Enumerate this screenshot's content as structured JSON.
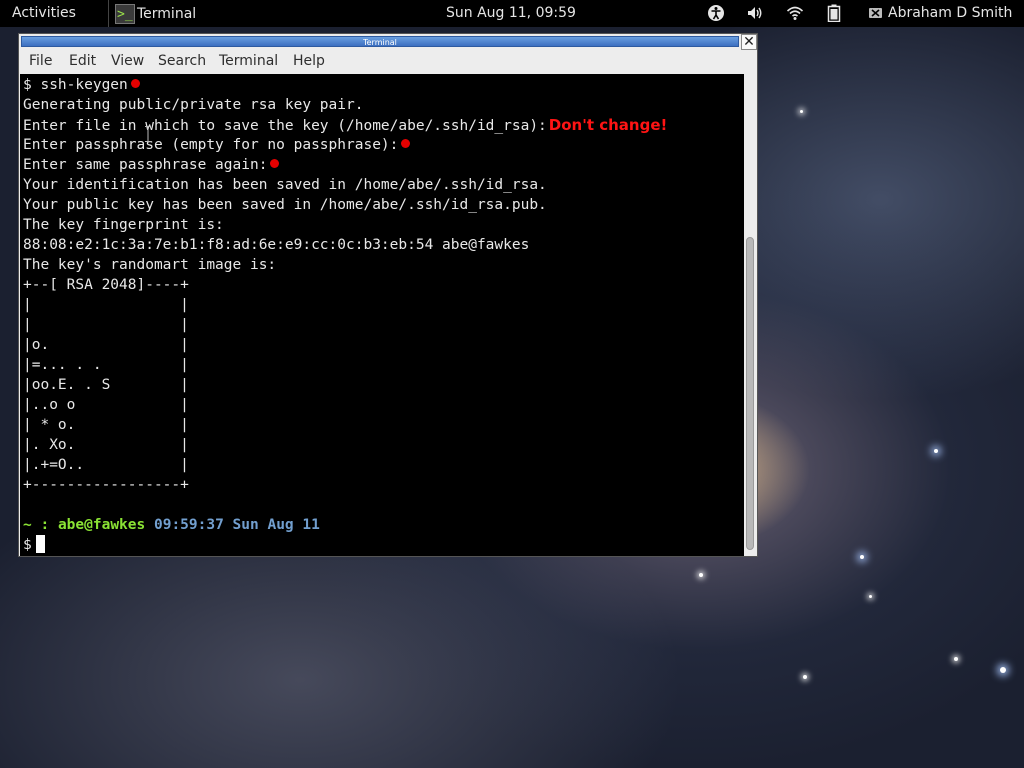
{
  "topbar": {
    "activities": "Activities",
    "app_icon_glyph": ">_",
    "app_name": "Terminal",
    "clock": "Sun Aug 11, 09:59",
    "user": "Abraham D Smith",
    "icons": [
      "accessibility-icon",
      "volume-icon",
      "wifi-icon",
      "battery-icon",
      "user-status-icon"
    ]
  },
  "window": {
    "title": "Terminal",
    "close_glyph": "✕",
    "menu": [
      "File",
      "Edit",
      "View",
      "Search",
      "Terminal",
      "Help"
    ]
  },
  "terminal": {
    "lines": [
      "$ ssh-keygen",
      "Generating public/private rsa key pair.",
      "Enter file in which to save the key (/home/abe/.ssh/id_rsa):",
      "Enter passphrase (empty for no passphrase):",
      "Enter same passphrase again:",
      "Your identification has been saved in /home/abe/.ssh/id_rsa.",
      "Your public key has been saved in /home/abe/.ssh/id_rsa.pub.",
      "The key fingerprint is:",
      "88:08:e2:1c:3a:7e:b1:f8:ad:6e:e9:cc:0c:b3:eb:54 abe@fawkes",
      "The key's randomart image is:",
      "+--[ RSA 2048]----+",
      "|                 |",
      "|                 |",
      "|o.               |",
      "|=... . .         |",
      "|oo.E. . S        |",
      "|..o o            |",
      "| * o.            |",
      "|. Xo.            |",
      "|.+=O..           |",
      "+-----------------+"
    ],
    "annotation": "Don't change!",
    "prompt_tilde": "~ :",
    "prompt_user": "abe@fawkes",
    "prompt_time": "09:59:37 Sun Aug 11",
    "prompt_symbol": "$"
  },
  "colors": {
    "dot": "#e50000",
    "annotation": "#ff1414",
    "prompt_green": "#8ae234",
    "prompt_blue": "#729fcf"
  }
}
